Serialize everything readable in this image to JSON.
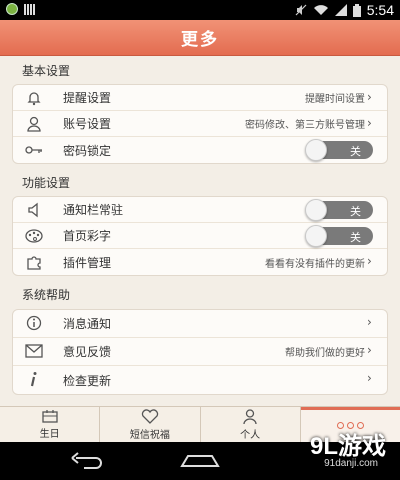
{
  "status_bar": {
    "time": "5:54",
    "icons": [
      "app-notification-icon",
      "signal-bars-icon",
      "mute-icon",
      "wifi-icon",
      "cell-signal-icon",
      "battery-icon"
    ]
  },
  "header": {
    "title": "更多"
  },
  "sections": [
    {
      "title": "基本设置",
      "items": [
        {
          "label": "提醒设置",
          "desc": "提醒时间设置",
          "icon": "bell-icon",
          "type": "link"
        },
        {
          "label": "账号设置",
          "desc": "密码修改、第三方账号管理",
          "icon": "user-icon",
          "type": "link"
        },
        {
          "label": "密码锁定",
          "toggle": "关",
          "icon": "key-icon",
          "type": "toggle"
        }
      ]
    },
    {
      "title": "功能设置",
      "items": [
        {
          "label": "通知栏常驻",
          "toggle": "关",
          "icon": "speaker-icon",
          "type": "toggle"
        },
        {
          "label": "首页彩字",
          "toggle": "关",
          "icon": "palette-icon",
          "type": "toggle"
        },
        {
          "label": "插件管理",
          "desc": "看看有没有插件的更新",
          "icon": "puzzle-icon",
          "type": "link"
        }
      ]
    },
    {
      "title": "系统帮助",
      "items": [
        {
          "label": "消息通知",
          "desc": "",
          "icon": "info-icon",
          "type": "link"
        },
        {
          "label": "意见反馈",
          "desc": "帮助我们做的更好",
          "icon": "envelope-icon",
          "type": "link"
        },
        {
          "label": "检查更新",
          "desc": "",
          "icon": "italic-i-icon",
          "type": "link"
        }
      ]
    }
  ],
  "tabs": [
    {
      "label": "生日",
      "icon": "calendar-icon"
    },
    {
      "label": "短信祝福",
      "icon": "heart-icon"
    },
    {
      "label": "个人",
      "icon": "person-icon"
    },
    {
      "label": "",
      "icon": "more-dots-icon",
      "active": true
    }
  ],
  "watermark": {
    "logo": "9L游戏",
    "url": "91danji.com"
  },
  "colors": {
    "accent": "#e36c50",
    "background": "#f3eee6",
    "toggle_off": "#7a7a7a"
  }
}
